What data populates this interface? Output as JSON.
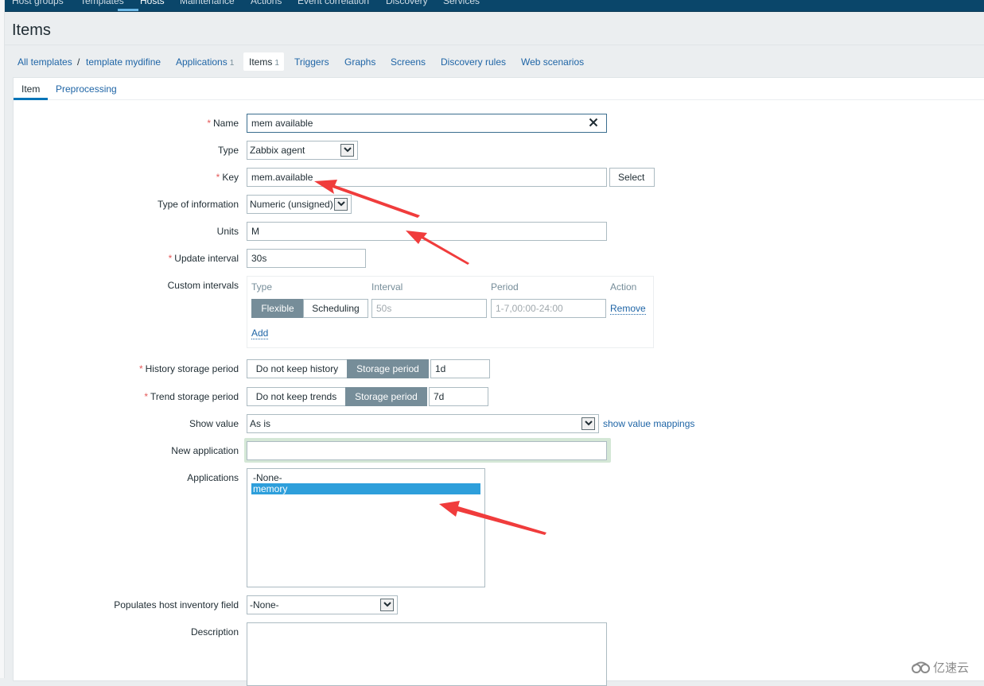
{
  "topnav": {
    "items": [
      "Host groups",
      "Templates",
      "Hosts",
      "Maintenance",
      "Actions",
      "Event correlation",
      "Discovery",
      "Services"
    ],
    "active": "Hosts"
  },
  "page": {
    "title": "Items"
  },
  "breadcrumbs": {
    "all_templates": "All templates",
    "separator": "/",
    "template": "template mydifine",
    "applications": "Applications",
    "applications_count": "1",
    "items": "Items",
    "items_count": "1",
    "triggers": "Triggers",
    "graphs": "Graphs",
    "screens": "Screens",
    "discovery_rules": "Discovery rules",
    "web_scenarios": "Web scenarios"
  },
  "tabs": {
    "item": "Item",
    "preprocessing": "Preprocessing"
  },
  "form": {
    "required_mark": "*",
    "name": {
      "label": "Name",
      "value": "mem available"
    },
    "type": {
      "label": "Type",
      "value": "Zabbix agent"
    },
    "key": {
      "label": "Key",
      "value": "mem.available",
      "select_button": "Select"
    },
    "type_of_information": {
      "label": "Type of information",
      "value": "Numeric (unsigned)"
    },
    "units": {
      "label": "Units",
      "value": "M"
    },
    "update_interval": {
      "label": "Update interval",
      "value": "30s"
    },
    "custom_intervals": {
      "label": "Custom intervals",
      "headers": {
        "type": "Type",
        "interval": "Interval",
        "period": "Period",
        "action": "Action"
      },
      "row": {
        "flexible": "Flexible",
        "scheduling": "Scheduling",
        "interval_placeholder": "50s",
        "period_placeholder": "1-7,00:00-24:00",
        "remove": "Remove"
      },
      "add": "Add"
    },
    "history": {
      "label": "History storage period",
      "option_off": "Do not keep history",
      "option_on": "Storage period",
      "value": "1d"
    },
    "trend": {
      "label": "Trend storage period",
      "option_off": "Do not keep trends",
      "option_on": "Storage period",
      "value": "7d"
    },
    "show_value": {
      "label": "Show value",
      "value": "As is",
      "link": "show value mappings"
    },
    "new_application": {
      "label": "New application",
      "value": ""
    },
    "applications": {
      "label": "Applications",
      "options": [
        "-None-",
        "memory"
      ],
      "selected": "memory"
    },
    "inventory": {
      "label": "Populates host inventory field",
      "value": "-None-"
    },
    "description": {
      "label": "Description",
      "value": ""
    }
  },
  "watermark": {
    "text": "亿速云"
  },
  "colors": {
    "nav_bg": "#0a466a",
    "link": "#1f65a6",
    "segment_active": "#768d99",
    "selected_option": "#2e9fdb",
    "required": "#e45959",
    "annotation_arrow": "#f03c3c"
  }
}
